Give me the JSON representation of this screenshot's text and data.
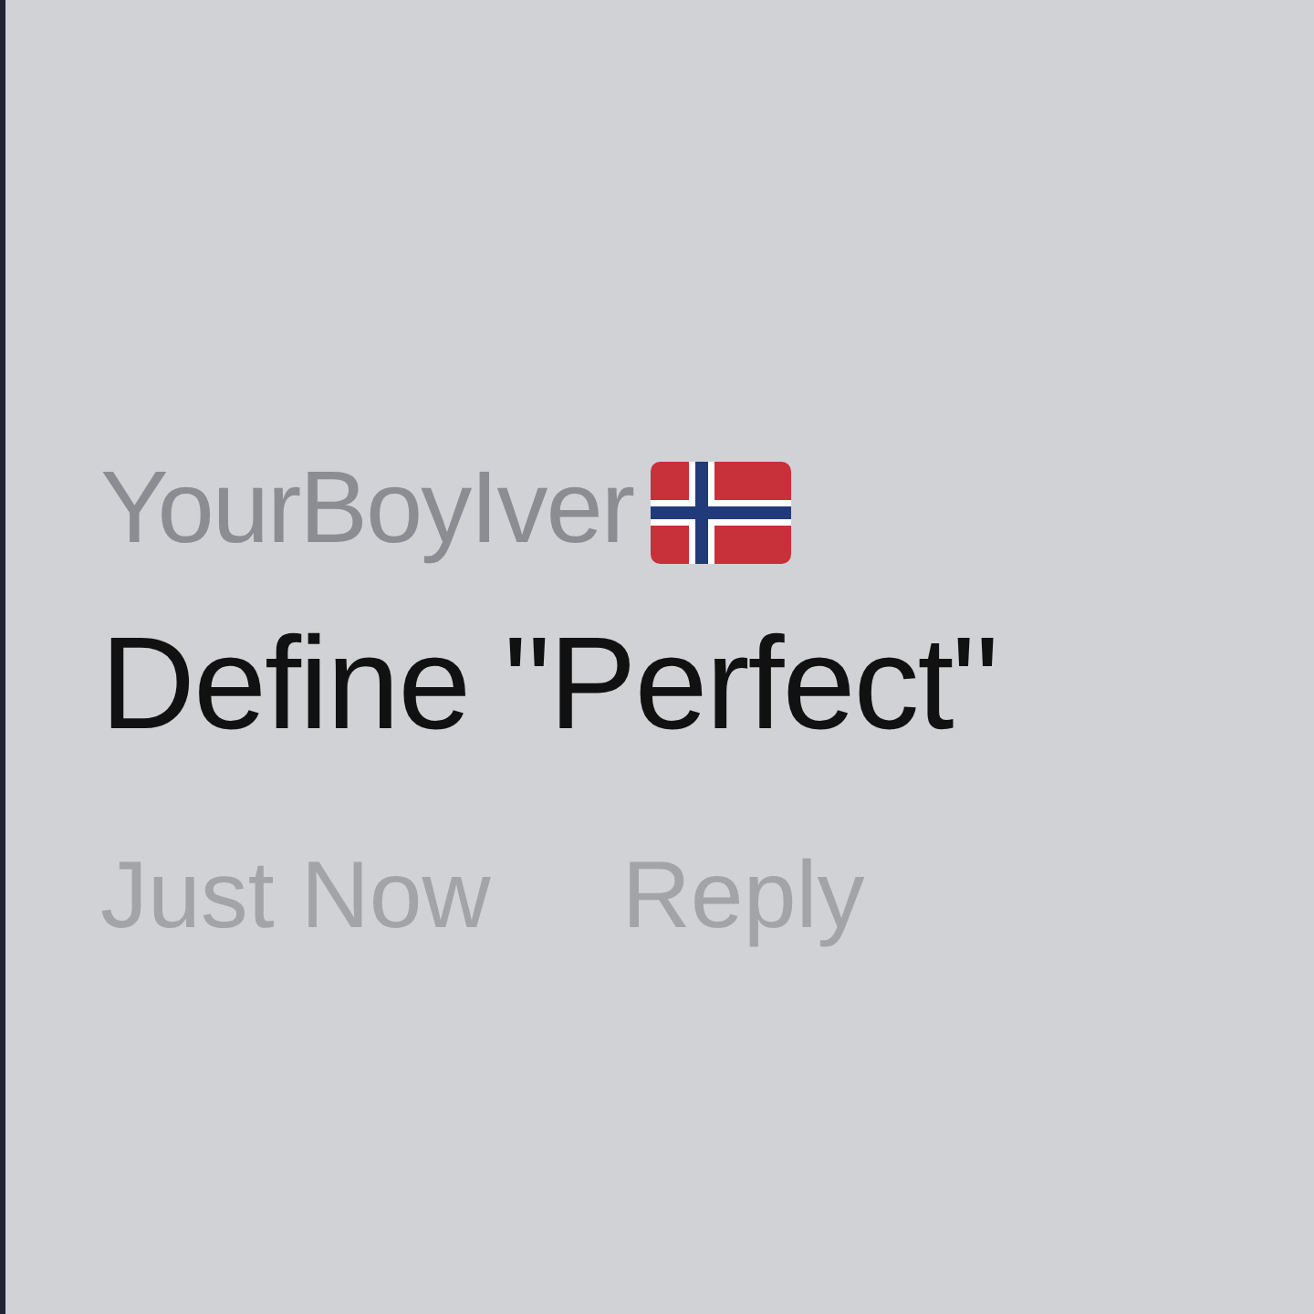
{
  "comment": {
    "username": "YourBoyIver",
    "text": "Define \"Perfect\"",
    "timestamp": "Just Now",
    "reply_label": "Reply"
  }
}
